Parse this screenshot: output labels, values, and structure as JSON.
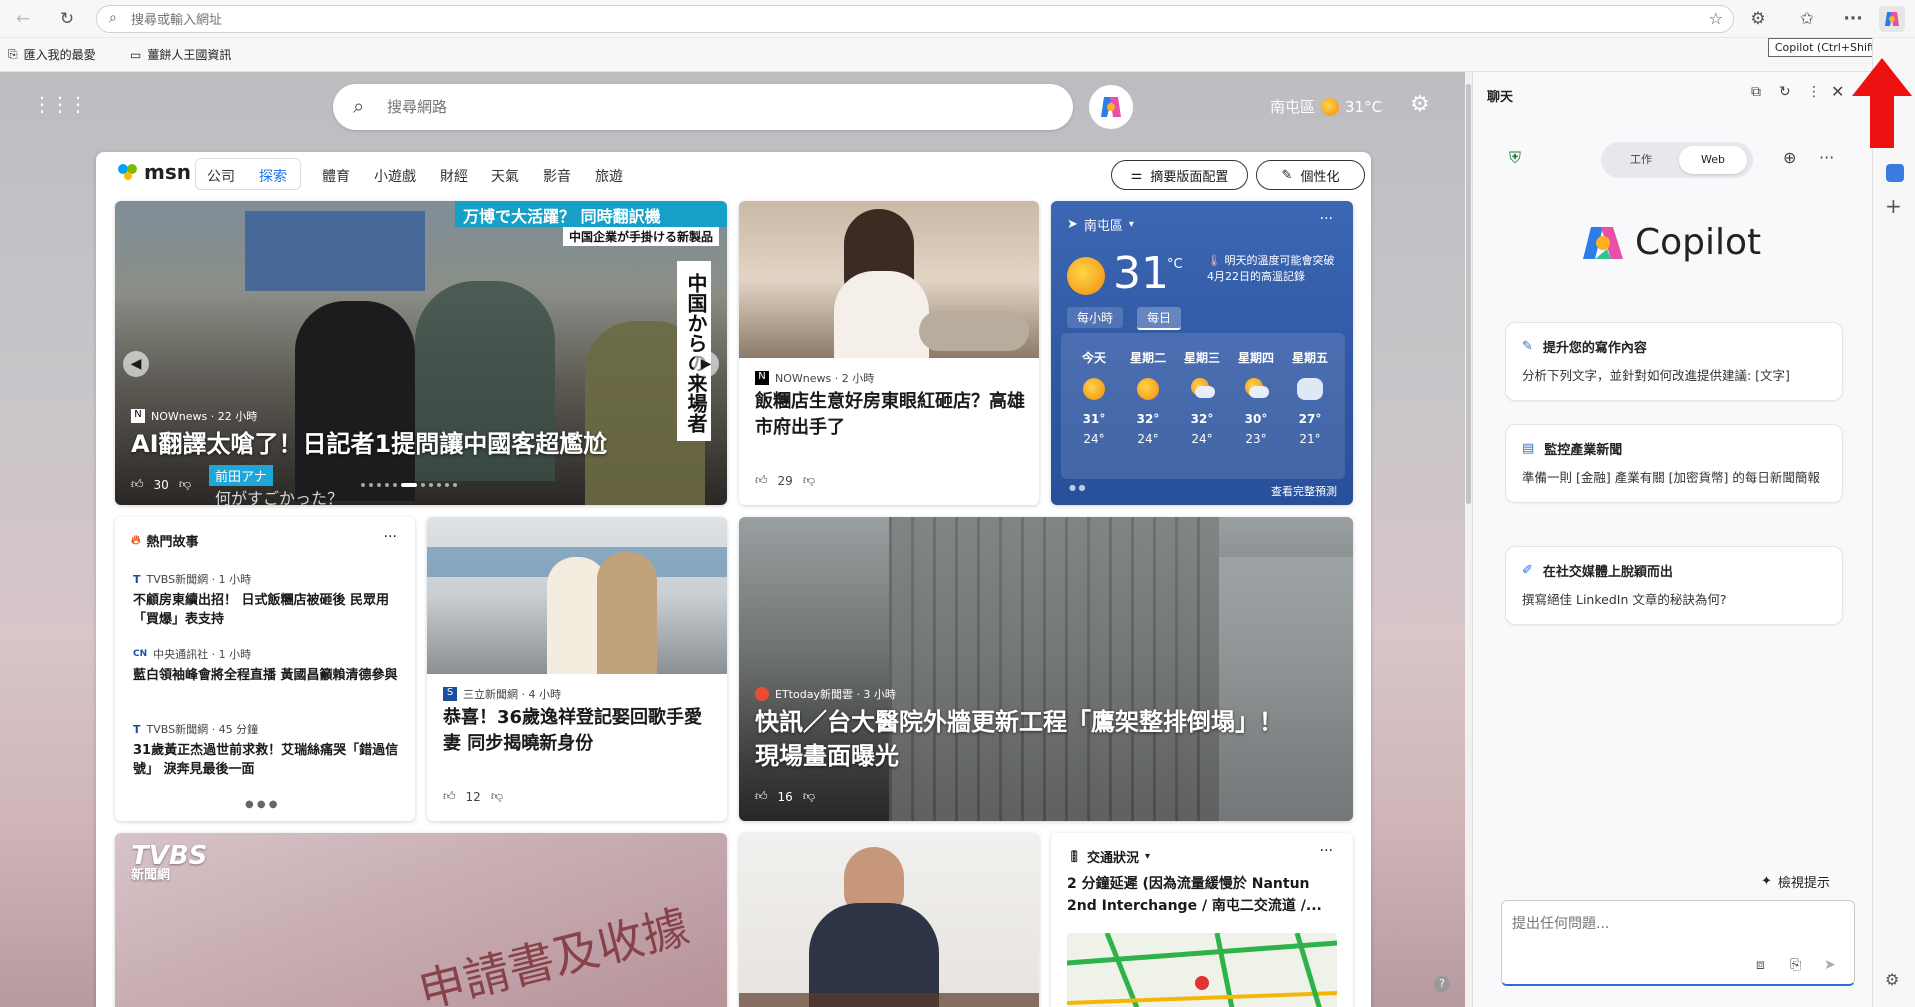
{
  "browser": {
    "address_placeholder": "搜尋或輸入網址",
    "tooltip": "Copilot (Ctrl+Shift+.)",
    "favorites": [
      "匯入我的最愛",
      "薑餅人王國資訊"
    ]
  },
  "msn": {
    "search_placeholder": "搜尋網路",
    "location": "南屯區",
    "temp": "31°C",
    "logo": "msn",
    "tabs": [
      "公司",
      "探索",
      "體育",
      "小遊戲",
      "財經",
      "天氣",
      "影音",
      "旅遊"
    ],
    "layout_btn": "摘要版面配置",
    "personalize_btn": "個性化"
  },
  "hero": {
    "banner_line1": "万博で大活躍？ 同時翻訳機",
    "banner_line2": "中国企業が手掛ける新製品",
    "vertical_caption": "中国からの来場者",
    "source": "NOWnews · 22 小時",
    "title": "AI翻譯太嗆了！日記者1提問讓中國客超尷尬",
    "likes": "30",
    "name_tag": "前田アナ",
    "sub_caption": "何がすごかった？"
  },
  "story2": {
    "source": "NOWnews · 2 小時",
    "title": "飯糰店生意好房東眼紅砸店？高雄市府出手了",
    "likes": "29"
  },
  "weather": {
    "location": "南屯區",
    "temp": "31",
    "unit": "°C",
    "alert": "明天的溫度可能會突破4月22日的高溫記錄",
    "tab_hourly": "每小時",
    "tab_daily": "每日",
    "days": [
      {
        "label": "今天",
        "hi": "31°",
        "lo": "24°",
        "icon": "sunny-icon"
      },
      {
        "label": "星期二",
        "hi": "32°",
        "lo": "24°",
        "icon": "sunny-icon"
      },
      {
        "label": "星期三",
        "hi": "32°",
        "lo": "24°",
        "icon": "partly-cloudy-icon"
      },
      {
        "label": "星期四",
        "hi": "30°",
        "lo": "23°",
        "icon": "partly-cloudy-icon"
      },
      {
        "label": "星期五",
        "hi": "27°",
        "lo": "21°",
        "icon": "rain-cloud-icon"
      }
    ],
    "full_forecast": "查看完整預測"
  },
  "trending": {
    "header": "熱門故事",
    "items": [
      {
        "source": "TVBS新聞網 · 1 小時",
        "title": "不顧房東續出招！ 日式飯糰店被砸後 民眾用「買爆」表支持"
      },
      {
        "source": "中央通訊社 · 1 小時",
        "title": "藍白領袖峰會將全程直播 黃國昌籲賴清德參與"
      },
      {
        "source": "TVBS新聞網 · 45 分鐘",
        "title": "31歲黃正杰過世前求救！艾瑞絲痛哭「錯過信號」 淚奔見最後一面"
      }
    ]
  },
  "story3": {
    "source": "三立新聞網 · 4 小時",
    "title": "恭喜！36歲逸祥登記娶回歌手愛妻 同步揭曉新身份",
    "likes": "12"
  },
  "story4": {
    "source": "ETtoday新聞雲 · 3 小時",
    "title": "快訊／台大醫院外牆更新工程「鷹架整排倒塌」！ 現場畫面曝光",
    "likes": "16"
  },
  "story5": {
    "logo_text": "TVBS",
    "logo_sub": "新聞網",
    "overlay_text": "申請書及收據"
  },
  "traffic": {
    "header": "交通狀況",
    "title": "2 分鐘延遲 (因為流量緩慢於 Nantun 2nd Interchange / 南屯二交流道 /..."
  },
  "copilot": {
    "header": "聊天",
    "mode_work": "工作",
    "mode_web": "Web",
    "brand": "Copilot",
    "prompts": [
      {
        "title": "提升您的寫作內容",
        "body": "分析下列文字，並針對如何改進提供建議: [文字]"
      },
      {
        "title": "監控產業新聞",
        "body": "準備一則 [金融] 產業有關 [加密貨幣] 的每日新聞簡報"
      },
      {
        "title": "在社交媒體上脫穎而出",
        "body": "撰寫絕佳 LinkedIn 文章的秘訣為何?"
      }
    ],
    "view_tips": "檢視提示",
    "input_placeholder": "提出任何問題..."
  }
}
